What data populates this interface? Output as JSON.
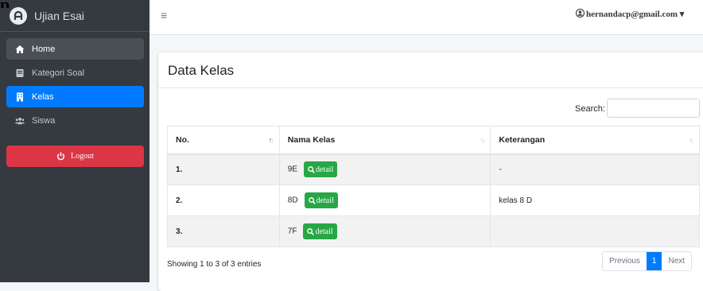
{
  "stray_text": "p",
  "sidebar": {
    "brand": "Ujian Esai",
    "items": [
      {
        "label": "Home",
        "icon": "home-icon"
      },
      {
        "label": "Kategori Soal",
        "icon": "book-icon"
      },
      {
        "label": "Kelas",
        "icon": "building-icon"
      },
      {
        "label": "Siswa",
        "icon": "users-icon"
      }
    ],
    "logout_label": "Logout"
  },
  "topbar": {
    "menu_glyph": "≡",
    "user": "hernandacp@gmail.com"
  },
  "card": {
    "title": "Data Kelas",
    "search_label": "Search:",
    "search_value": ""
  },
  "table": {
    "headers": [
      "No.",
      "Nama Kelas",
      "Keterangan"
    ],
    "detail_label": "detail",
    "rows": [
      {
        "no": "1.",
        "nama": "9E",
        "ket": "-"
      },
      {
        "no": "2.",
        "nama": "8D",
        "ket": "kelas 8 D"
      },
      {
        "no": "3.",
        "nama": "7F",
        "ket": ""
      }
    ]
  },
  "footer": {
    "info": "Showing 1 to 3 of 3 entries",
    "prev": "Previous",
    "page": "1",
    "next": "Next"
  },
  "colors": {
    "sidebar": "#343a40",
    "active": "#007bff",
    "logout": "#dc3545",
    "detail": "#28a745"
  }
}
